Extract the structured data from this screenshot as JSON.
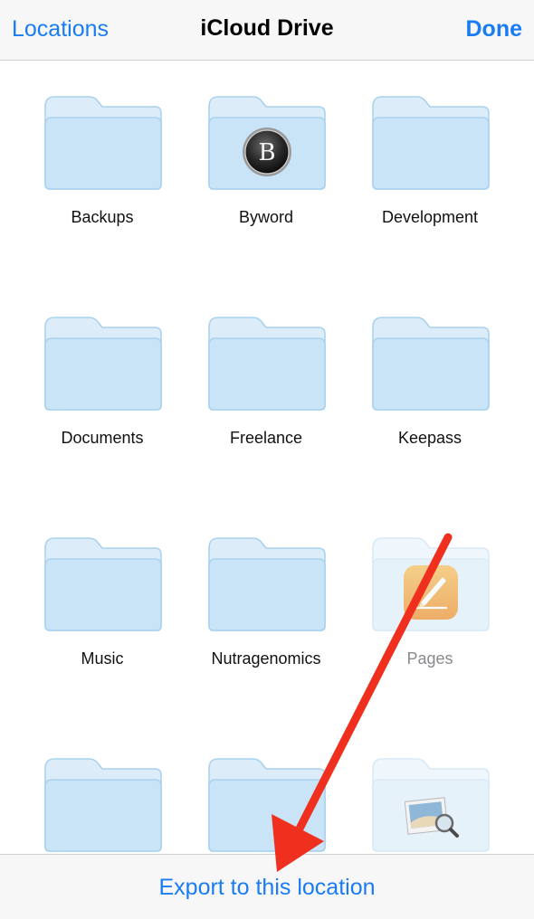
{
  "navbar": {
    "left_label": "Locations",
    "title": "iCloud Drive",
    "right_label": "Done"
  },
  "folders": [
    {
      "label": "Backups",
      "badge": ""
    },
    {
      "label": "Byword",
      "badge": "B"
    },
    {
      "label": "Development",
      "badge": ""
    },
    {
      "label": "Documents",
      "badge": ""
    },
    {
      "label": "Freelance",
      "badge": ""
    },
    {
      "label": "Keepass",
      "badge": ""
    },
    {
      "label": "Music",
      "badge": ""
    },
    {
      "label": "Nutragenomics",
      "badge": ""
    },
    {
      "label": "Pages",
      "badge": "pages-app-icon",
      "disabled": true
    },
    {
      "label": "",
      "badge": ""
    },
    {
      "label": "",
      "badge": ""
    },
    {
      "label": "",
      "badge": "preview-app-icon",
      "disabled": true
    }
  ],
  "bottom": {
    "export_label": "Export to this location"
  },
  "colors": {
    "accent": "#1a7cf2",
    "folder_back": "#d8ecf8",
    "folder_front": "#c7e3f5",
    "folder_stroke": "#a9d1ee",
    "arrow": "#f0301e"
  }
}
